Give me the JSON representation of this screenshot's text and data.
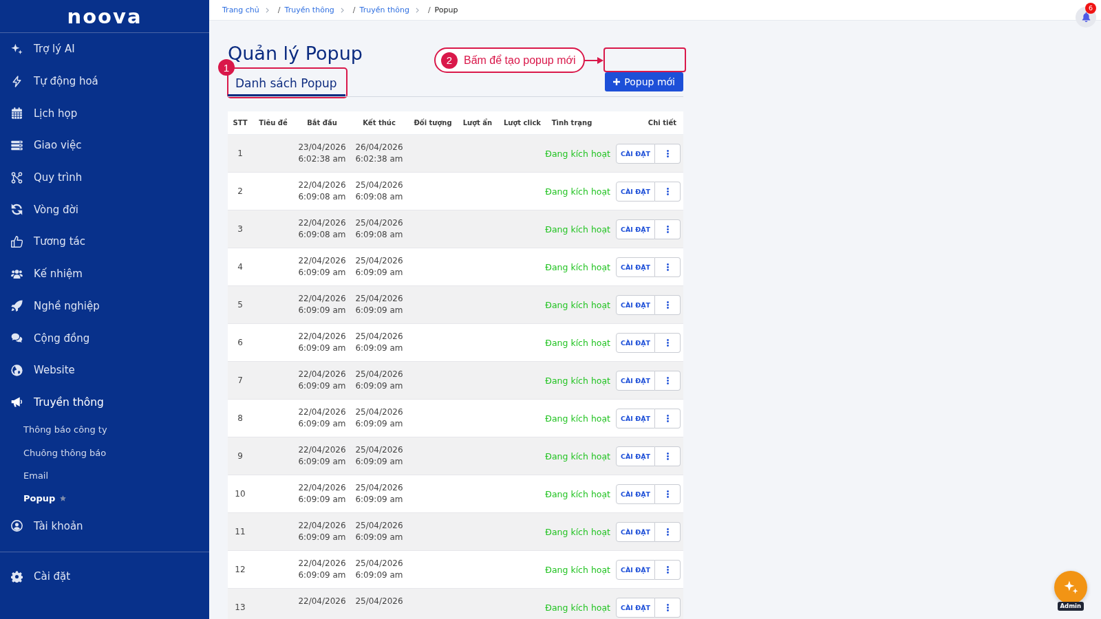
{
  "sidebar": {
    "logo": "noova",
    "items": [
      {
        "label": "Trợ lý AI",
        "selected": false
      },
      {
        "label": "Tự động hoá",
        "selected": false
      },
      {
        "label": "Lịch họp",
        "selected": false
      },
      {
        "label": "Giao việc",
        "selected": false
      },
      {
        "label": "Quy trình",
        "selected": false
      },
      {
        "label": "Vòng đời",
        "selected": false
      },
      {
        "label": "Tương tác",
        "selected": false
      },
      {
        "label": "Kế nhiệm",
        "selected": false
      },
      {
        "label": "Nghề nghiệp",
        "selected": false
      },
      {
        "label": "Cộng đồng",
        "selected": false
      },
      {
        "label": "Website",
        "selected": false
      },
      {
        "label": "Truyền thông",
        "selected": true,
        "children": [
          {
            "label": "Thông báo công ty",
            "selected": false,
            "starred": false
          },
          {
            "label": "Chuông thông báo",
            "selected": false,
            "starred": false
          },
          {
            "label": "Email",
            "selected": false,
            "starred": false
          },
          {
            "label": "Popup",
            "selected": true,
            "starred": true
          }
        ]
      },
      {
        "label": "Tài khoản",
        "selected": false
      }
    ],
    "footer_items": [
      {
        "label": "Cài đặt",
        "selected": false
      }
    ]
  },
  "breadcrumb": [
    {
      "label": "Trang chủ",
      "current": false
    },
    {
      "separator": "/",
      "label": "Truyền thông",
      "current": false
    },
    {
      "separator": "/",
      "label": "Truyền thông",
      "current": false
    },
    {
      "separator": "/",
      "label": "Popup",
      "current": true
    }
  ],
  "notifications": {
    "count": "6"
  },
  "page": {
    "title": "Quản lý Popup",
    "tabs": [
      {
        "label": "Danh sách Popup",
        "selected": true
      }
    ],
    "new_button": "Popup mới"
  },
  "annotations": [
    {
      "number": "1"
    },
    {
      "number": "2",
      "text": "Bấm để tạo popup mới"
    }
  ],
  "table": {
    "columns": [
      "STT",
      "Tiêu đề",
      "Bắt đầu",
      "Kết thúc",
      "Đối tượng",
      "Lượt ẩn",
      "Lượt click",
      "Tình trạng",
      "Chi tiết"
    ],
    "rows": [
      {
        "stt": "1",
        "start": [
          "23/04/2026",
          "6:02:38 am"
        ],
        "end": [
          "26/04/2026",
          "6:02:38 am"
        ],
        "status": "Đang kích hoạt",
        "button": "CÀI ĐẶT"
      },
      {
        "stt": "2",
        "start": [
          "22/04/2026",
          "6:09:08 am"
        ],
        "end": [
          "25/04/2026",
          "6:09:08 am"
        ],
        "status": "Đang kích hoạt",
        "button": "CÀI ĐẶT"
      },
      {
        "stt": "3",
        "start": [
          "22/04/2026",
          "6:09:08 am"
        ],
        "end": [
          "25/04/2026",
          "6:09:08 am"
        ],
        "status": "Đang kích hoạt",
        "button": "CÀI ĐẶT"
      },
      {
        "stt": "4",
        "start": [
          "22/04/2026",
          "6:09:09 am"
        ],
        "end": [
          "25/04/2026",
          "6:09:09 am"
        ],
        "status": "Đang kích hoạt",
        "button": "CÀI ĐẶT"
      },
      {
        "stt": "5",
        "start": [
          "22/04/2026",
          "6:09:09 am"
        ],
        "end": [
          "25/04/2026",
          "6:09:09 am"
        ],
        "status": "Đang kích hoạt",
        "button": "CÀI ĐẶT"
      },
      {
        "stt": "6",
        "start": [
          "22/04/2026",
          "6:09:09 am"
        ],
        "end": [
          "25/04/2026",
          "6:09:09 am"
        ],
        "status": "Đang kích hoạt",
        "button": "CÀI ĐẶT"
      },
      {
        "stt": "7",
        "start": [
          "22/04/2026",
          "6:09:09 am"
        ],
        "end": [
          "25/04/2026",
          "6:09:09 am"
        ],
        "status": "Đang kích hoạt",
        "button": "CÀI ĐẶT"
      },
      {
        "stt": "8",
        "start": [
          "22/04/2026",
          "6:09:09 am"
        ],
        "end": [
          "25/04/2026",
          "6:09:09 am"
        ],
        "status": "Đang kích hoạt",
        "button": "CÀI ĐẶT"
      },
      {
        "stt": "9",
        "start": [
          "22/04/2026",
          "6:09:09 am"
        ],
        "end": [
          "25/04/2026",
          "6:09:09 am"
        ],
        "status": "Đang kích hoạt",
        "button": "CÀI ĐẶT"
      },
      {
        "stt": "10",
        "start": [
          "22/04/2026",
          "6:09:09 am"
        ],
        "end": [
          "25/04/2026",
          "6:09:09 am"
        ],
        "status": "Đang kích hoạt",
        "button": "CÀI ĐẶT"
      },
      {
        "stt": "11",
        "start": [
          "22/04/2026",
          "6:09:09 am"
        ],
        "end": [
          "25/04/2026",
          "6:09:09 am"
        ],
        "status": "Đang kích hoạt",
        "button": "CÀI ĐẶT"
      },
      {
        "stt": "12",
        "start": [
          "22/04/2026",
          "6:09:09 am"
        ],
        "end": [
          "25/04/2026",
          "6:09:09 am"
        ],
        "status": "Đang kích hoạt",
        "button": "CÀI ĐẶT"
      },
      {
        "stt": "13",
        "start": [
          "22/04/2026"
        ],
        "end": [
          "25/04/2026"
        ],
        "status": "Đang kích hoạt",
        "button": "CÀI ĐẶT"
      }
    ]
  },
  "assistant": {
    "label": "Admin"
  }
}
